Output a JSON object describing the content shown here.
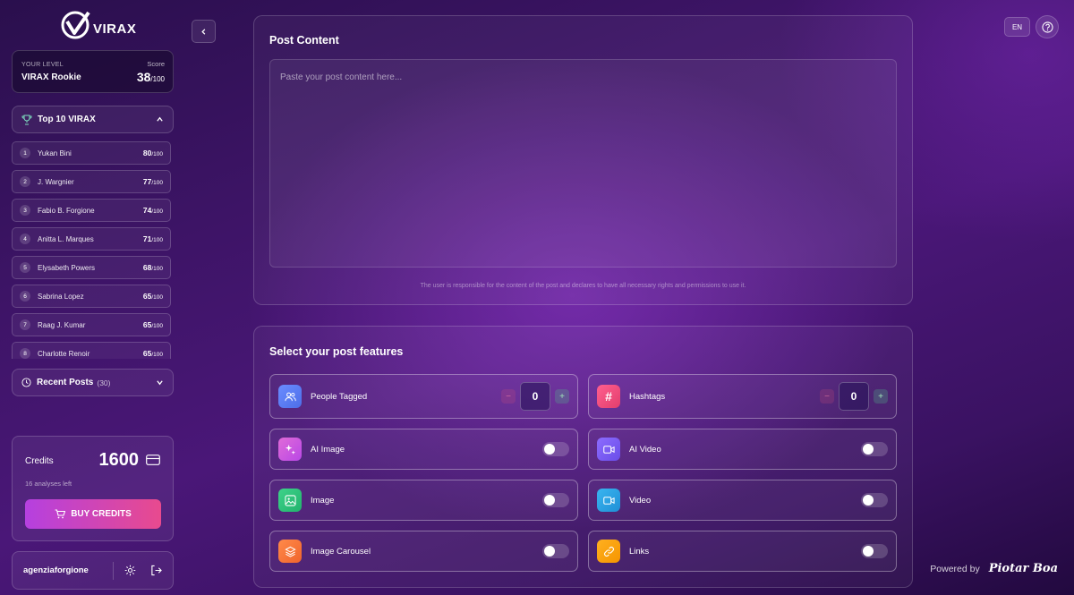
{
  "app": {
    "logo_text": "VIRAX"
  },
  "level": {
    "label": "YOUR LEVEL",
    "name": "VIRAX Rookie",
    "score_label": "Score",
    "score": "38",
    "score_max": "/100"
  },
  "top10": {
    "title": "Top 10 VIRAX"
  },
  "ranking": [
    {
      "rank": "1",
      "name": "Yukan Bini",
      "score": "80",
      "max": "/100"
    },
    {
      "rank": "2",
      "name": "J. Wargnier",
      "score": "77",
      "max": "/100"
    },
    {
      "rank": "3",
      "name": "Fabio B. Forgione",
      "score": "74",
      "max": "/100"
    },
    {
      "rank": "4",
      "name": "Anitta L. Marques",
      "score": "71",
      "max": "/100"
    },
    {
      "rank": "5",
      "name": "Elysabeth Powers",
      "score": "68",
      "max": "/100"
    },
    {
      "rank": "6",
      "name": "Sabrina Lopez",
      "score": "65",
      "max": "/100"
    },
    {
      "rank": "7",
      "name": "Raag J. Kumar",
      "score": "65",
      "max": "/100"
    },
    {
      "rank": "8",
      "name": "Charlotte Renoir",
      "score": "65",
      "max": "/100"
    }
  ],
  "recent": {
    "title": "Recent Posts",
    "count": "(30)"
  },
  "credits": {
    "label": "Credits",
    "amount": "1600",
    "analyses_left": "16 analyses left",
    "buy_label": "BUY CREDITS"
  },
  "user": {
    "name": "agenziaforgione"
  },
  "header": {
    "lang": "EN"
  },
  "post": {
    "title": "Post Content",
    "placeholder": "Paste your post content here...",
    "disclaimer": "The user is responsible for the content of the post and declares to have all necessary rights and permissions to use it."
  },
  "features": {
    "title": "Select your post features",
    "people_tagged": {
      "label": "People Tagged",
      "value": "0"
    },
    "hashtags": {
      "label": "Hashtags",
      "value": "0"
    },
    "ai_image": {
      "label": "AI Image",
      "on": false
    },
    "ai_video": {
      "label": "AI Video",
      "on": false
    },
    "image": {
      "label": "Image",
      "on": false
    },
    "video": {
      "label": "Video",
      "on": false
    },
    "carousel": {
      "label": "Image Carousel",
      "on": false
    },
    "links": {
      "label": "Links",
      "on": false
    }
  },
  "footer": {
    "powered_by": "Powered by",
    "brand": "Piotar Boa"
  },
  "colors": {
    "accent_pink": "#e84a8e",
    "accent_purple": "#b540e0",
    "bg": "#3d1466"
  }
}
